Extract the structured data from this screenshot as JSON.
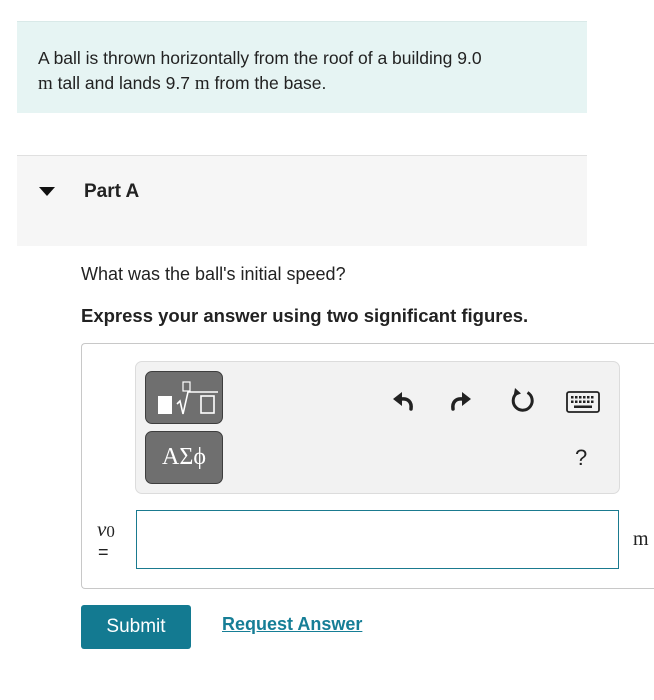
{
  "problem": {
    "text_part1": "A ball is thrown horizontally from the roof of a building 9.0",
    "unit1": "m",
    "text_part2": "tall and lands 9.7",
    "unit2": "m",
    "text_part3": "from the base."
  },
  "part": {
    "title": "Part A",
    "expanded": true
  },
  "question": "What was the ball's initial speed?",
  "instruction": "Express your answer using two significant figures.",
  "toolbar": {
    "template_icon": "fraction-root-template-icon",
    "greek_label": "ΑΣϕ",
    "undo_icon": "undo-icon",
    "redo_icon": "redo-icon",
    "reset_icon": "reset-icon",
    "keyboard_icon": "keyboard-icon",
    "help_label": "?"
  },
  "answer": {
    "variable": "v",
    "subscript": "0",
    "equals": "=",
    "value": "",
    "unit": "m"
  },
  "actions": {
    "submit_label": "Submit",
    "request_label": "Request Answer"
  },
  "colors": {
    "accent": "#137a91",
    "problem_bg": "#e6f4f3",
    "tool_button": "#6f6f6f"
  }
}
